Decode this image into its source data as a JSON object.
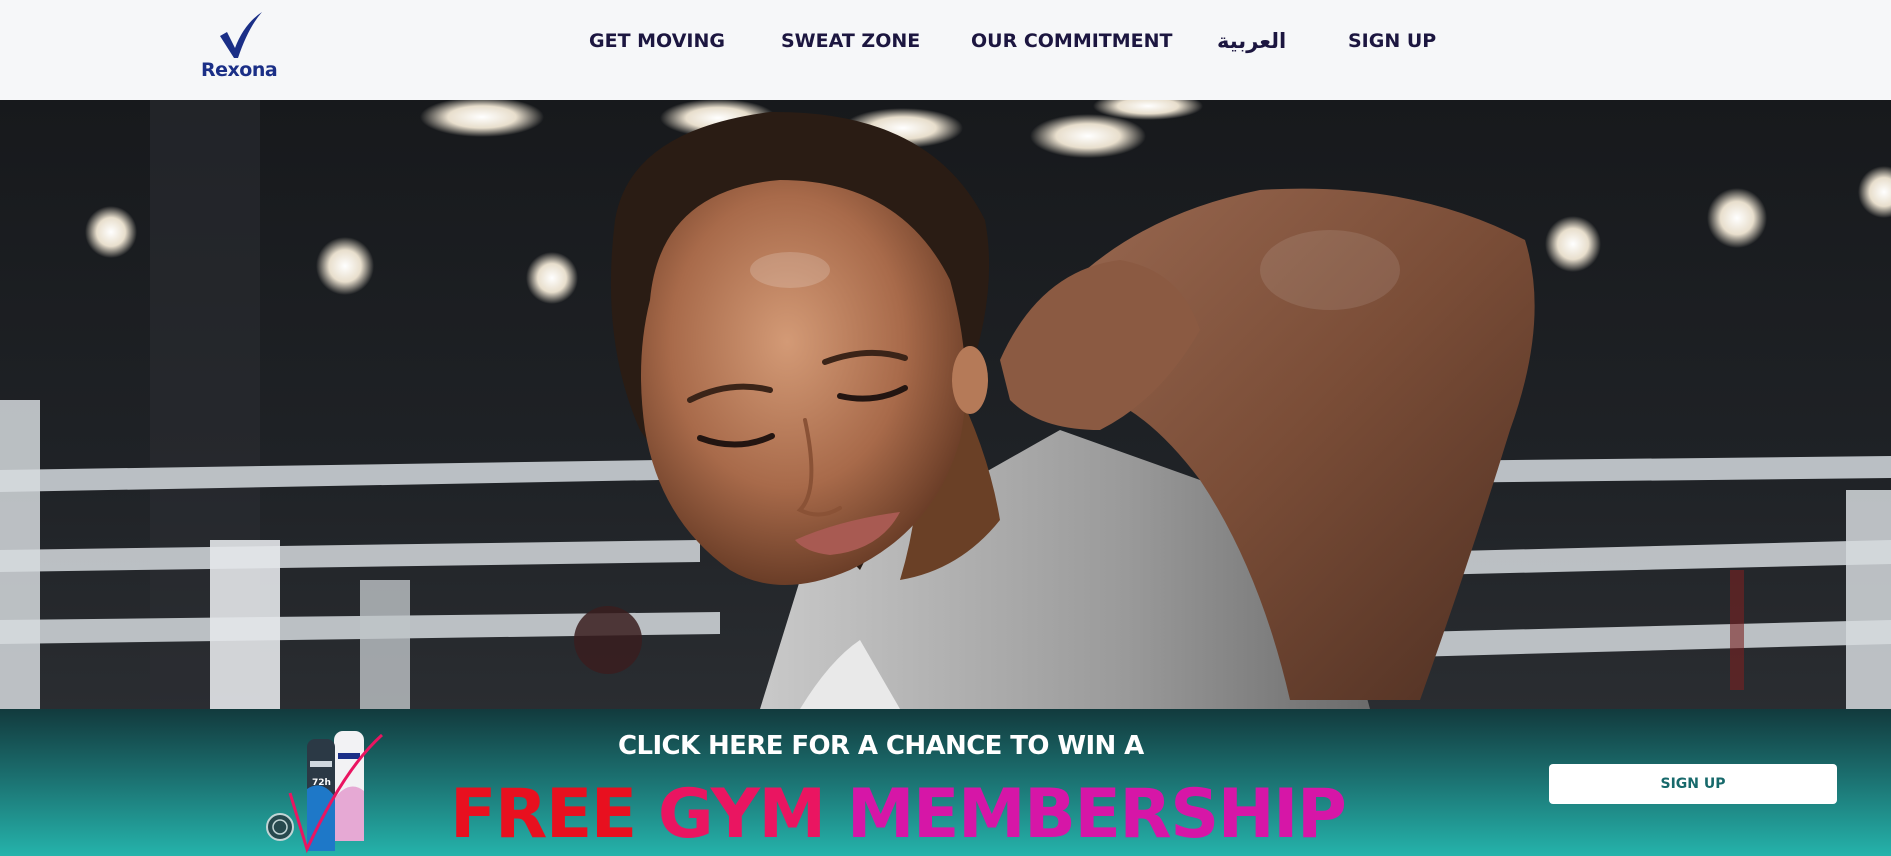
{
  "header": {
    "logo_text": "Rexona",
    "nav": [
      {
        "label": "GET MOVING"
      },
      {
        "label": "SWEAT ZONE"
      },
      {
        "label": "OUR COMMITMENT"
      },
      {
        "label": "العربية"
      },
      {
        "label": "SIGN UP"
      }
    ]
  },
  "hero": {
    "image": "woman-in-boxing-ring-stretching-arm"
  },
  "banner": {
    "line1": "CLICK HERE FOR A CHANCE TO WIN A",
    "line2_word1": "FREE",
    "line2_word2": "GYM",
    "line2_word3": "MEMBERSHIP",
    "button_label": "SIGN UP",
    "product_image": "rexona-deodorant-cans"
  },
  "colors": {
    "brand_navy": "#1b2f87",
    "nav_text": "#1c1640",
    "banner_teal": "#25b3ab",
    "free_red": "#e8101f",
    "gym_pink": "#ea1561",
    "membership_magenta": "#d616a7"
  }
}
